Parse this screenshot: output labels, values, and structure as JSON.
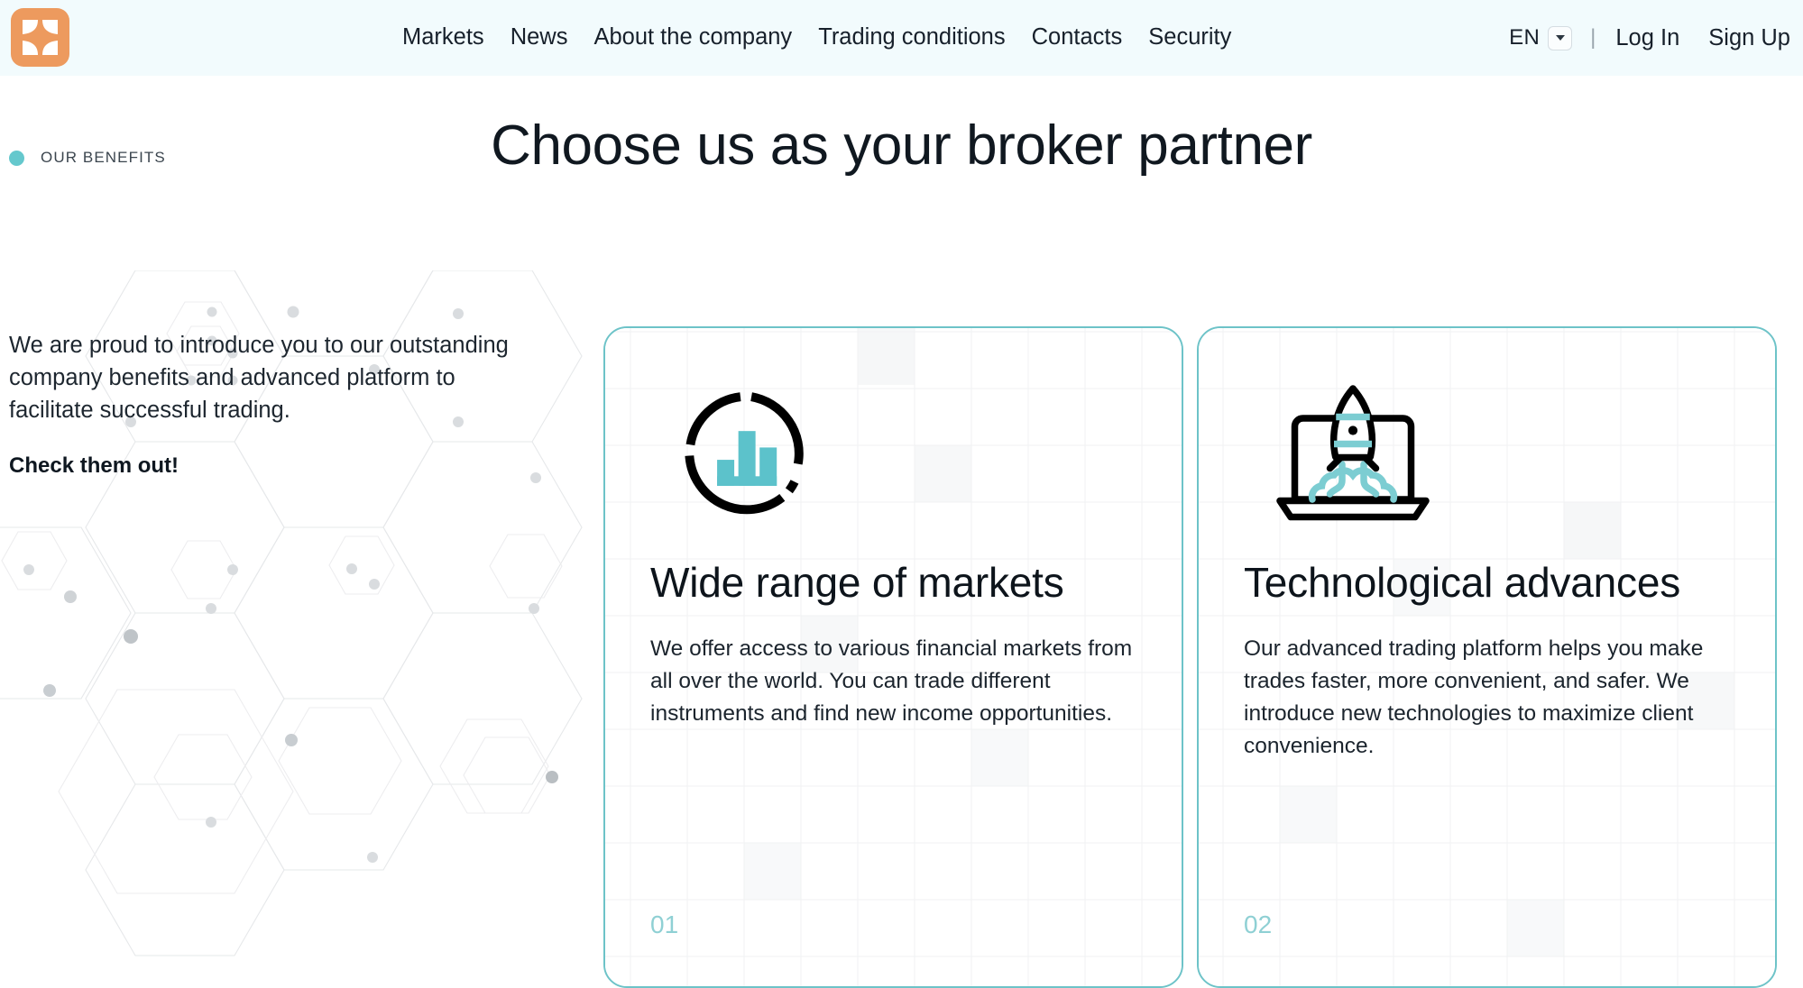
{
  "header": {
    "logo_name": "broker-logo",
    "nav": [
      {
        "label": "Markets"
      },
      {
        "label": "News"
      },
      {
        "label": "About the company"
      },
      {
        "label": "Trading conditions"
      },
      {
        "label": "Contacts"
      },
      {
        "label": "Security"
      }
    ],
    "language": {
      "label": "EN",
      "caret": "chevron-down-icon"
    },
    "separator": "|",
    "login_label": "Log In",
    "signup_label": "Sign Up",
    "background_color": "#f2fbfd",
    "logo_color": "#ed9a5e"
  },
  "section": {
    "eyebrow": "OUR BENEFITS",
    "eyebrow_dot_color": "#65c8cd",
    "title": "Choose us as your broker partner"
  },
  "intro": {
    "paragraph": "We are proud to introduce you to our outstanding company benefits and advanced platform to facilitate successful trading.",
    "cta": "Check them out!"
  },
  "cards": [
    {
      "icon": "donut-chart-bars-icon",
      "title": "Wide range of markets",
      "description": "We offer access to various financial markets from all over the world. You can trade different instruments and find new income opportunities.",
      "number": "01"
    },
    {
      "icon": "rocket-laptop-icon",
      "title": "Technological advances",
      "description": "Our advanced trading platform helps you make trades faster, more convenient, and safer. We introduce new technologies to maximize client convenience.",
      "number": "02"
    }
  ],
  "theme": {
    "accent": "#6dc3c8",
    "accent_light": "#8fd0d4",
    "text": "#101820",
    "page_background": "#ffffff"
  }
}
